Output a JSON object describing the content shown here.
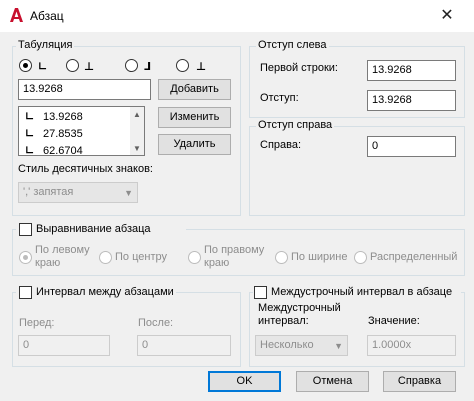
{
  "window": {
    "title": "Абзац",
    "close_icon": "close-icon"
  },
  "tabs": {
    "legend": "Табуляция",
    "stops": [
      {
        "glyph": "∟",
        "selected": true
      },
      {
        "glyph": "⊥",
        "selected": false
      },
      {
        "glyph": "⅃",
        "selected": false
      },
      {
        "glyph": "⊥",
        "selected": false
      }
    ],
    "value": "13.9268",
    "list": [
      "13.9268",
      "27.8535",
      "62.6704"
    ],
    "add_label": "Добавить",
    "change_label": "Изменить",
    "delete_label": "Удалить",
    "decimal_label": "Стиль десятичных знаков:",
    "decimal_value": "',' запятая"
  },
  "left_indent": {
    "legend": "Отступ слева",
    "first_line_label": "Первой строки:",
    "first_line_value": "13.9268",
    "indent_label": "Отступ:",
    "indent_value": "13.9268"
  },
  "right_indent": {
    "legend": "Отступ справа",
    "right_label": "Справа:",
    "right_value": "0"
  },
  "alignment": {
    "legend": "Выравнивание абзаца",
    "options": [
      "По левому краю",
      "По центру",
      "По правому краю",
      "По ширине",
      "Распределенный"
    ],
    "left_line1": "По левому",
    "left_line2": "краю",
    "right_line1": "По правому",
    "right_line2": "краю"
  },
  "spacing": {
    "legend": "Интервал между абзацами",
    "before_label": "Перед:",
    "before_value": "0",
    "after_label": "После:",
    "after_value": "0"
  },
  "line_spacing": {
    "legend": "Междустрочный интервал в абзаце",
    "type_label_1": "Междустрочный",
    "type_label_2": "интервал:",
    "type_value": "Несколько",
    "value_label": "Значение:",
    "value": "1.0000x"
  },
  "buttons": {
    "ok": "OK",
    "cancel": "Отмена",
    "help": "Справка"
  }
}
